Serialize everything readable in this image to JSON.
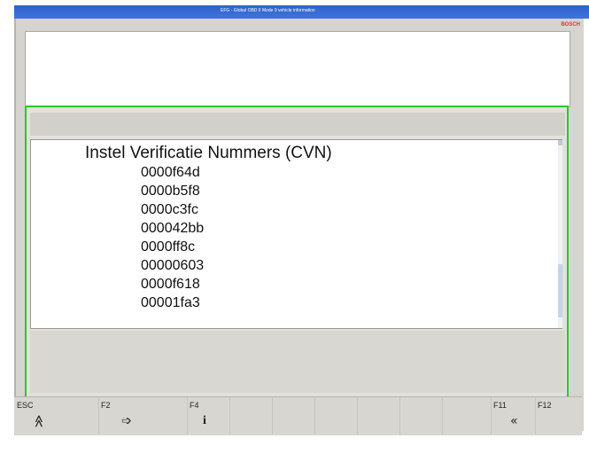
{
  "window": {
    "title": "EFG - Global OBD II Mode 9 vehicle information",
    "brand": "BOSCH"
  },
  "cvn": {
    "title": "Instel Verificatie Nummers (CVN)",
    "items": [
      "0000f64d",
      "0000b5f8",
      "0000c3fc",
      "000042bb",
      "0000ff8c",
      "00000603",
      "0000f618",
      "00001fa3"
    ]
  },
  "function_keys": [
    {
      "key": "ESC",
      "icon_name": "double-chevron-up-icon",
      "glyph": "≪",
      "enabled": true
    },
    {
      "key": "F2",
      "icon_name": "arrow-right-icon",
      "glyph": "➩",
      "enabled": true
    },
    {
      "key": "F4",
      "icon_name": "info-icon",
      "glyph": "i",
      "enabled": true
    },
    {
      "key": "F11",
      "icon_name": "double-chevron-left-icon",
      "glyph": "«",
      "enabled": true
    },
    {
      "key": "F12",
      "icon_name": "blank-disabled-icon",
      "glyph": "",
      "enabled": false
    }
  ]
}
